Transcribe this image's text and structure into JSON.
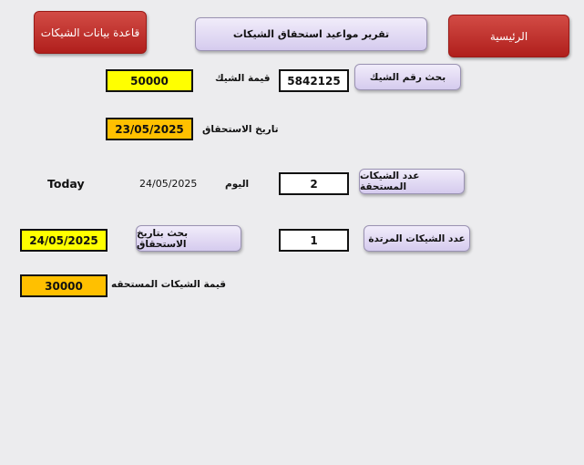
{
  "nav": {
    "home": "الرئيسية",
    "database": "قاعدة بيانات الشيكات",
    "title": "تقرير مواعيد استحقاق الشيكات"
  },
  "search_cheque": {
    "button": "بحث رقم الشيك",
    "cheque_number": "5842125",
    "value_label": "قيمة الشيك",
    "value": "50000",
    "due_label": "تاريخ الاستحقاق",
    "due_date": "23/05/2025"
  },
  "today_row": {
    "count_button": "عدد الشيكات المستحقة",
    "count": "2",
    "today_label": "اليوم",
    "today_date": "24/05/2025",
    "today_text": "Today"
  },
  "returned_row": {
    "count_button": "عدد الشيكات المرتدة",
    "count": "1",
    "search_button": "بحث بتاريخ الاستحقاق",
    "search_date": "24/05/2025"
  },
  "due_total": {
    "label": "قيمة الشيكات المستحقه",
    "value": "30000"
  },
  "colors": {
    "red_button": "#c0302c",
    "lavender_button": "#e4ddf5",
    "yellow_field": "#ffff00",
    "orange_field": "#ffc000"
  }
}
